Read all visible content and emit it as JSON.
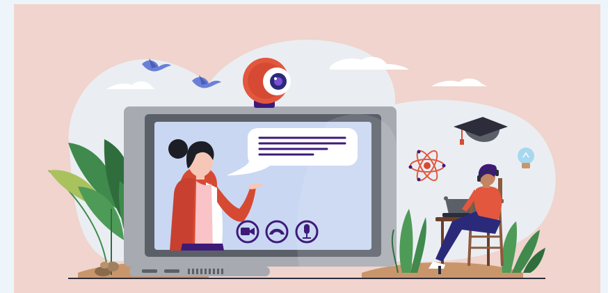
{
  "illustration": {
    "subject": "online-learning-video-call",
    "call_controls": [
      {
        "icon": "video-camera-icon"
      },
      {
        "icon": "end-call-icon"
      },
      {
        "icon": "microphone-icon"
      }
    ],
    "decorations": [
      "bird-icon",
      "bird-icon",
      "cloud-icon",
      "cloud-icon",
      "cloud-icon",
      "graduation-cap-icon",
      "atom-icon",
      "lightbulb-icon",
      "plant-icon"
    ]
  },
  "colors": {
    "page_background": "#edf5fa",
    "panel_background": "#f0d4cd",
    "blob": "#eaeef3",
    "laptop_frame": "#a7aab1",
    "laptop_bezel": "#5b5f68",
    "screen": "#c9d7f2",
    "webcam": "#e2573e",
    "teacher_jacket": "#d64a33",
    "student_shirt": "#e2573e",
    "accent_purple": "#3d1a78",
    "plant_green": "#3f8a4c",
    "ground": "#c9966c"
  }
}
